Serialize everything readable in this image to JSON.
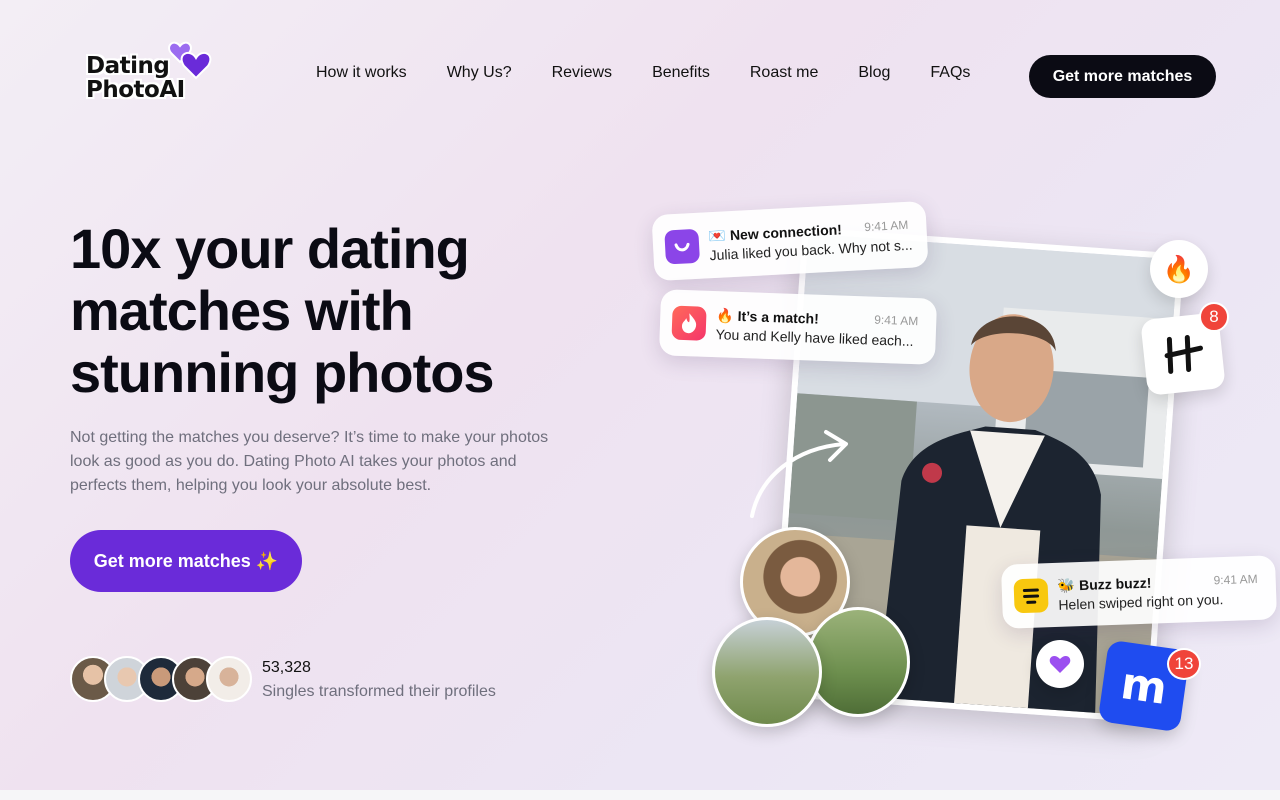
{
  "brand": {
    "line1": "Dating",
    "line2": "PhotoAI"
  },
  "nav": {
    "items": [
      "How it works",
      "Why Us?",
      "Reviews",
      "Benefits",
      "Roast me",
      "Blog",
      "FAQs"
    ],
    "cta": "Get more matches"
  },
  "hero": {
    "title": "10x your dating matches with stunning photos",
    "description": "Not getting the matches you deserve? It’s time to make your photos look as good as you do. Dating Photo AI takes your photos and perfects them, helping you look your absolute best.",
    "cta": "Get more matches ✨",
    "social_count": "53,328",
    "social_label": "Singles transformed their profiles"
  },
  "notifications": [
    {
      "emoji": "💌",
      "title": "New connection!",
      "message": "Julia liked you back. Why not s...",
      "time": "9:41 AM",
      "app_icon": "hinge-smile-icon"
    },
    {
      "emoji": "🔥",
      "title": "It’s a match!",
      "message": "You and Kelly have liked each...",
      "time": "9:41 AM",
      "app_icon": "tinder-flame-icon"
    },
    {
      "emoji": "🐝",
      "title": "Buzz buzz!",
      "message": "Helen swiped right on you.",
      "time": "9:41 AM",
      "app_icon": "bumble-icon"
    }
  ],
  "badges": {
    "hinge_count": "8",
    "match_count": "13"
  },
  "colors": {
    "primary": "#6a2bd9",
    "dark": "#0b0b14",
    "badge_red": "#f0443a"
  }
}
